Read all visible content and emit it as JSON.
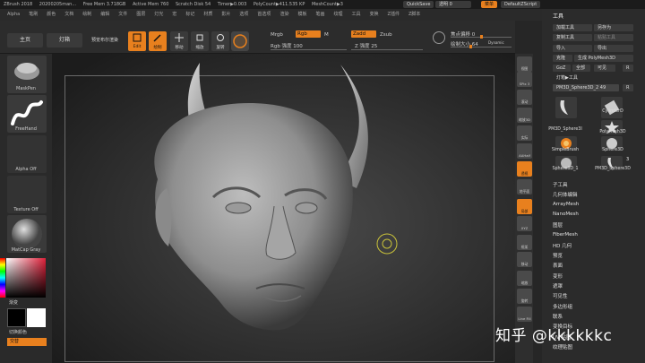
{
  "titlebar": {
    "app": "ZBrush 2018",
    "project": "20200205man...",
    "free_mem": "Free Mem 3.718GB",
    "active_mem": "Active Mem 760",
    "scratch_disk": "Scratch Disk 54",
    "timer": "Timer▶0.003",
    "poly_count": "PolyCount▶411.535 KP",
    "mesh_count": "MeshCount▶3",
    "quicksave": "QuickSave",
    "transparency": "透明 0",
    "menu": "菜单",
    "script": "DefaultZScript"
  },
  "menubar": [
    "Alpha",
    "笔刷",
    "颜色",
    "文档",
    "绘制",
    "编辑",
    "文件",
    "图层",
    "灯光",
    "宏",
    "标记",
    "材质",
    "影片",
    "选项",
    "首选项",
    "渲染",
    "模板",
    "笔画",
    "纹理",
    "工具",
    "变换",
    "Z插件",
    "Z脚本"
  ],
  "shelf": {
    "home": "主页",
    "lightbox": "灯箱",
    "preview_render": "预览布尔渲染",
    "tools": [
      "Edit",
      "绘制",
      "移动",
      "缩放",
      "旋转"
    ],
    "mrgb": "Mrgb",
    "rgb": "Rgb",
    "m": "M",
    "rgb_intensity": "Rgb 强度 100",
    "zadd": "Zadd",
    "zsub": "Zsub",
    "z_intensity": "Z 强度 25",
    "focal_shift": "焦点偏移 0",
    "draw_size": "绘制大小 64",
    "dynamic": "Dynamic"
  },
  "leftpanel": {
    "brush1": "MaskPen",
    "brush2": "FreeHand",
    "alpha": "Alpha Off",
    "texture": "Texture Off",
    "material": "MatCap Gray",
    "gradient": "渐变",
    "switch_color": "切换颜色",
    "alternate": "交替"
  },
  "rightstrip": [
    "视图",
    "SPix 3",
    "滚动",
    "缩放3D",
    "实际",
    "AAHalf",
    "透视",
    "地平面",
    "局部",
    "XYZ",
    "框架",
    "移动",
    "缩放",
    "旋转",
    "Line Fill"
  ],
  "toolpanel": {
    "title": "工具",
    "load_tool": "加载工具",
    "save_as": "另存为",
    "copy_tool": "复制工具",
    "paste_tool": "粘贴工具",
    "import": "导入",
    "export": "导出",
    "clone": "克隆",
    "make_polymesh": "生成 PolyMesh3D",
    "goz": "GoZ",
    "all": "全部",
    "visible": "可见",
    "r": "R",
    "lightbox_tools": "灯箱▶工具",
    "current_tool": "PM3D_Sphere3D_2",
    "current_tool_value": "49",
    "r2": "R",
    "thumbs": [
      "PM3D_Sphere3I",
      "CylinderD",
      "PolyMesh3D",
      "SimpleBrush",
      "Sphere3D",
      "Sphere3D_1",
      "PM3D_Sphere3D"
    ],
    "thumb_count": "3",
    "subpanels": [
      "子工具",
      "几何体编辑",
      "ArrayMesh",
      "NanoMesh",
      "图层",
      "FiberMesh",
      "HD 几何",
      "预览",
      "表面",
      "变形",
      "遮罩",
      "可见性",
      "多边形组",
      "联系",
      "变换目标",
      "UV 贴图",
      "纹理贴图"
    ]
  },
  "watermark": "知乎 @kkkkkkc",
  "colors": {
    "accent": "#e8801e",
    "panel": "#2b2b2b",
    "viewport": "#3a3a3a"
  }
}
